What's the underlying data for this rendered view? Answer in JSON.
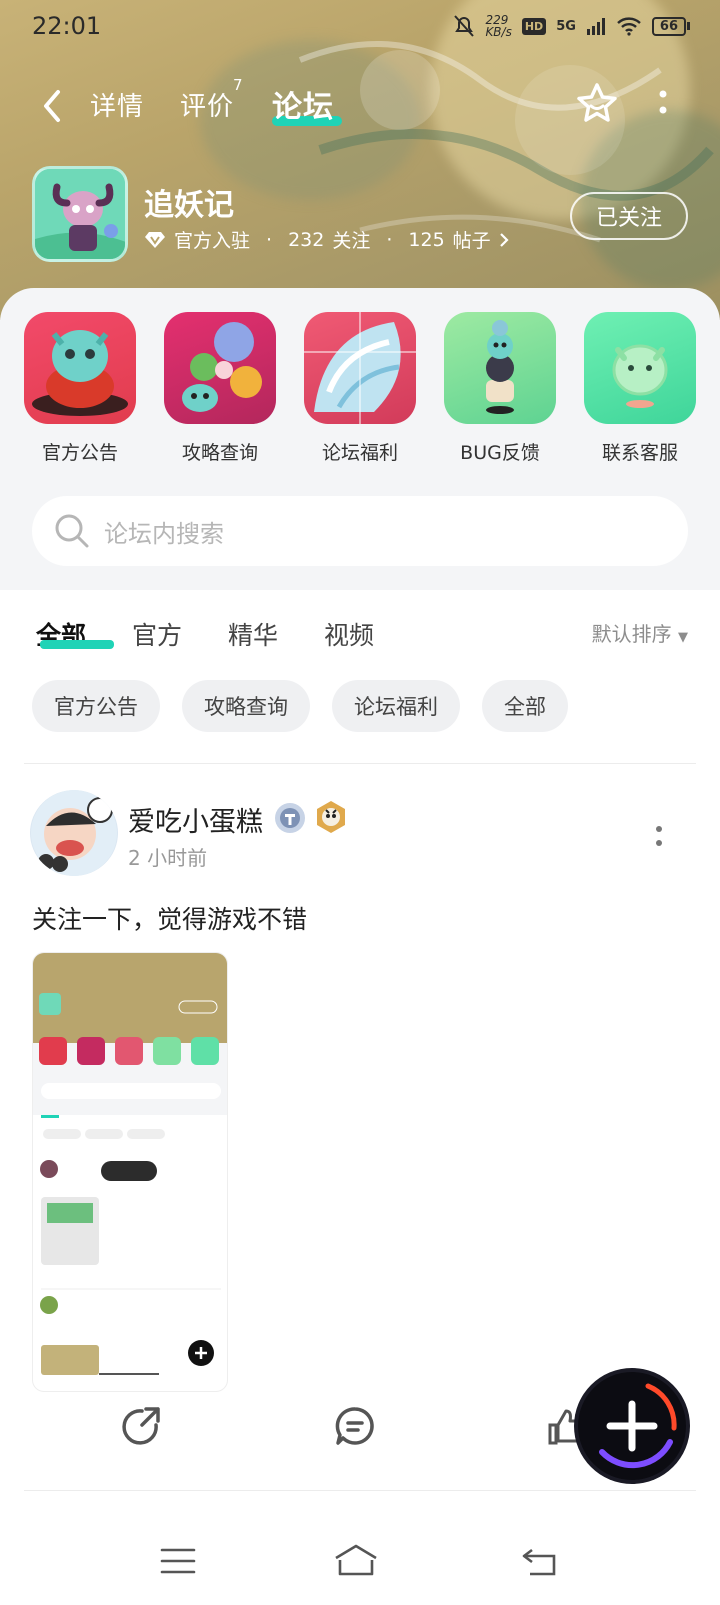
{
  "status_bar": {
    "time": "22:01",
    "net_speed": "229",
    "net_unit": "KB/s",
    "hd": "HD",
    "signal": "5G",
    "battery": "66"
  },
  "nav": {
    "tabs": [
      {
        "label": "详情"
      },
      {
        "label": "评价",
        "badge": "7"
      },
      {
        "label": "论坛"
      }
    ],
    "active_tab": "论坛"
  },
  "game": {
    "title": "追妖记",
    "official": "官方入驻",
    "followers_count": "232",
    "followers_label": "关注",
    "posts_count": "125",
    "posts_label": "帖子",
    "follow_button": "已关注"
  },
  "shortcuts": [
    {
      "label": "官方公告",
      "icon": "announcement-icon"
    },
    {
      "label": "攻略查询",
      "icon": "guide-icon"
    },
    {
      "label": "论坛福利",
      "icon": "welfare-icon"
    },
    {
      "label": "BUG反馈",
      "icon": "bug-report-icon"
    },
    {
      "label": "联系客服",
      "icon": "customer-service-icon"
    }
  ],
  "search": {
    "placeholder": "论坛内搜索"
  },
  "filter_tabs": [
    {
      "label": "全部"
    },
    {
      "label": "官方"
    },
    {
      "label": "精华"
    },
    {
      "label": "视频"
    }
  ],
  "sort": {
    "label": "默认排序"
  },
  "chips": [
    {
      "label": "官方公告"
    },
    {
      "label": "攻略查询"
    },
    {
      "label": "论坛福利"
    },
    {
      "label": "全部"
    }
  ],
  "post": {
    "username": "爱吃小蛋糕",
    "time": "2 小时前",
    "text": "关注一下，觉得游戏不错"
  },
  "colors": {
    "accent": "#1fd3b6",
    "hero": "#b9a46a",
    "panel": "#f4f5f7"
  }
}
